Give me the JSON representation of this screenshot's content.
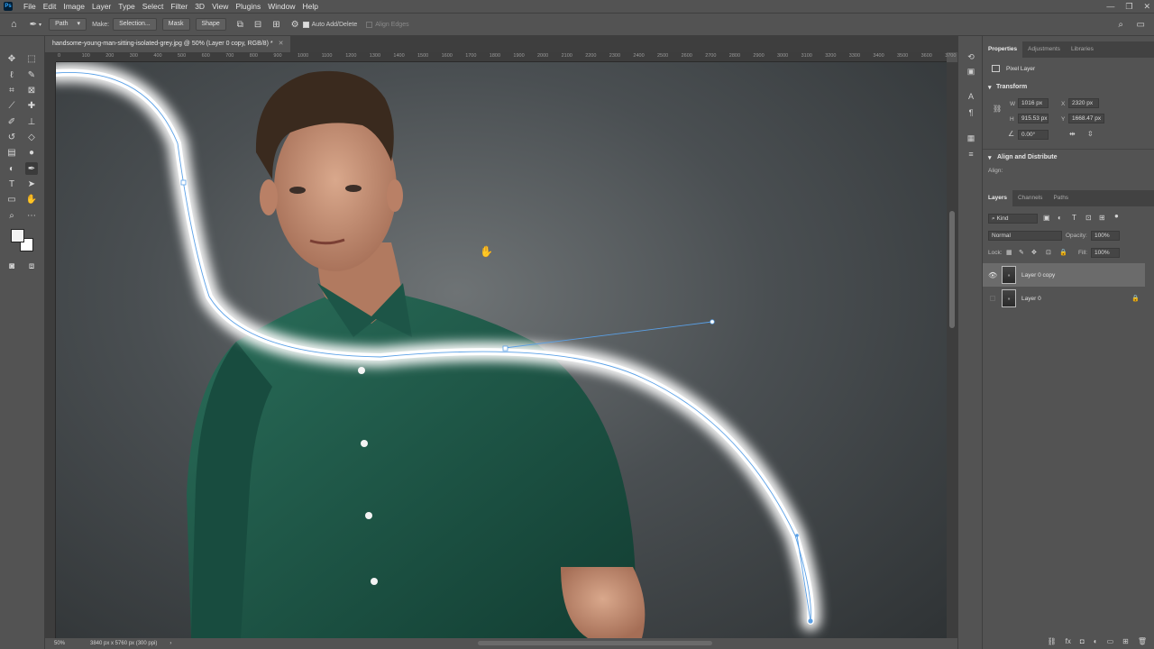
{
  "menubar": {
    "logo": "Ps",
    "items": [
      "File",
      "Edit",
      "Image",
      "Layer",
      "Type",
      "Select",
      "Filter",
      "3D",
      "View",
      "Plugins",
      "Window",
      "Help"
    ],
    "window_controls": [
      "—",
      "❐",
      "✕"
    ]
  },
  "optionsbar": {
    "mode_value": "Path",
    "make_label": "Make:",
    "selection_btn": "Selection...",
    "mask_btn": "Mask",
    "shape_btn": "Shape",
    "auto_add_delete": "Auto Add/Delete",
    "align_edges": "Align Edges"
  },
  "document": {
    "tab_title": "handsome-young-man-sitting-isolated-grey.jpg @ 50% (Layer 0 copy, RGB/8) *",
    "ruler_ticks": [
      "0",
      "100",
      "200",
      "300",
      "400",
      "500",
      "600",
      "700",
      "800",
      "900",
      "1000",
      "1100",
      "1200",
      "1300",
      "1400",
      "1500",
      "1600",
      "1700",
      "1800",
      "1900",
      "2000",
      "2100",
      "2200",
      "2300",
      "2400",
      "2500",
      "2600",
      "2700",
      "2800",
      "2900",
      "3000",
      "3100",
      "3200",
      "3300",
      "3400",
      "3500",
      "3600",
      "3700"
    ],
    "zoom": "50%",
    "doc_size": "3840 px x 5760 px (300 ppi)"
  },
  "properties": {
    "tabs": [
      "Properties",
      "Adjustments",
      "Libraries"
    ],
    "layer_kind": "Pixel Layer",
    "transform_title": "Transform",
    "w_label": "W",
    "w_value": "1016 px",
    "x_label": "X",
    "x_value": "2320 px",
    "h_label": "H",
    "h_value": "915.53 px",
    "y_label": "Y",
    "y_value": "1668.47 px",
    "angle_value": "0.00°",
    "align_title": "Align and Distribute",
    "align_label": "Align:"
  },
  "layers": {
    "tabs": [
      "Layers",
      "Channels",
      "Paths"
    ],
    "kind_filter": "Kind",
    "blend_mode": "Normal",
    "opacity_label": "Opacity:",
    "opacity_value": "100%",
    "lock_label": "Lock:",
    "fill_label": "Fill:",
    "fill_value": "100%",
    "items": [
      {
        "name": "Layer 0 copy",
        "visible": true,
        "selected": true
      },
      {
        "name": "Layer 0",
        "visible": false,
        "locked": true
      }
    ]
  },
  "colors": {
    "foreground": "#f2f2f2",
    "background": "#ffffff",
    "path_stroke": "#5aa0e6",
    "shirt": "#1e5a49"
  }
}
